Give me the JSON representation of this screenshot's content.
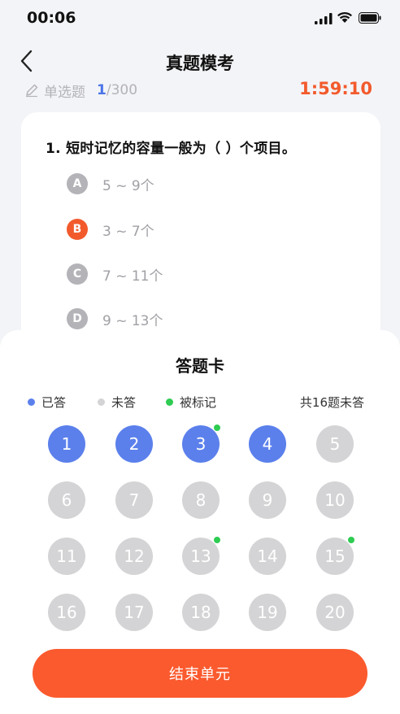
{
  "status": {
    "time": "00:06"
  },
  "nav": {
    "title": "真题模考"
  },
  "progress": {
    "type_label": "单选题",
    "current": "1",
    "total": "/300",
    "timer": "1:59:10"
  },
  "question": {
    "text": "1.  短时记忆的容量一般为（      ）个项目。",
    "options": [
      {
        "letter": "A",
        "text": "5 ~ 9个",
        "selected": false
      },
      {
        "letter": "B",
        "text": "3 ~ 7个",
        "selected": true
      },
      {
        "letter": "C",
        "text": "7 ~ 11个",
        "selected": false
      },
      {
        "letter": "D",
        "text": "9 ~ 13个",
        "selected": false
      }
    ]
  },
  "sheet": {
    "title": "答题卡",
    "legend": {
      "answered": "已答",
      "unanswered": "未答",
      "marked": "被标记"
    },
    "unanswered_count": "共16题未答",
    "questions": [
      {
        "n": "1",
        "answered": true,
        "marked": false
      },
      {
        "n": "2",
        "answered": true,
        "marked": false
      },
      {
        "n": "3",
        "answered": true,
        "marked": true
      },
      {
        "n": "4",
        "answered": true,
        "marked": false
      },
      {
        "n": "5",
        "answered": false,
        "marked": false
      },
      {
        "n": "6",
        "answered": false,
        "marked": false
      },
      {
        "n": "7",
        "answered": false,
        "marked": false
      },
      {
        "n": "8",
        "answered": false,
        "marked": false
      },
      {
        "n": "9",
        "answered": false,
        "marked": false
      },
      {
        "n": "10",
        "answered": false,
        "marked": false
      },
      {
        "n": "11",
        "answered": false,
        "marked": false
      },
      {
        "n": "12",
        "answered": false,
        "marked": false
      },
      {
        "n": "13",
        "answered": false,
        "marked": true
      },
      {
        "n": "14",
        "answered": false,
        "marked": false
      },
      {
        "n": "15",
        "answered": false,
        "marked": true
      },
      {
        "n": "16",
        "answered": false,
        "marked": false
      },
      {
        "n": "17",
        "answered": false,
        "marked": false
      },
      {
        "n": "18",
        "answered": false,
        "marked": false
      },
      {
        "n": "19",
        "answered": false,
        "marked": false
      },
      {
        "n": "20",
        "answered": false,
        "marked": false
      }
    ],
    "finish_label": "结束单元"
  },
  "colors": {
    "accent": "#f25a2c",
    "answered": "#5b80ec",
    "unanswered": "#d4d4d6",
    "marked": "#2ecc52"
  }
}
